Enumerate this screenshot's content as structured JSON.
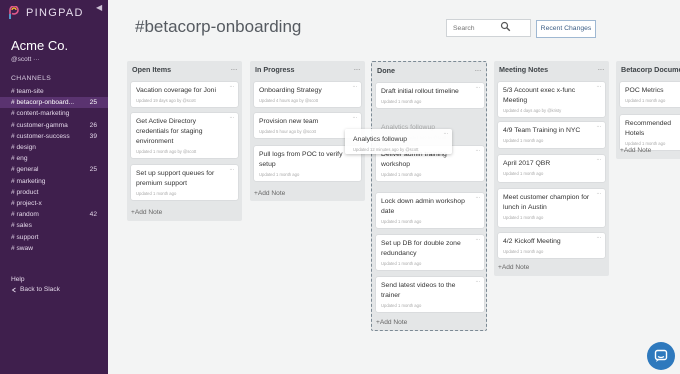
{
  "sidebar": {
    "logo_text": "PINGPAD",
    "org_name": "Acme Co.",
    "user": "@scott ···",
    "channels_heading": "CHANNELS",
    "channels": [
      {
        "name": "# team-site",
        "count": ""
      },
      {
        "name": "# betacorp-onboard...",
        "count": "25",
        "active": true
      },
      {
        "name": "# content-marketing",
        "count": ""
      },
      {
        "name": "# customer-gamma",
        "count": "26"
      },
      {
        "name": "# customer-success",
        "count": "39"
      },
      {
        "name": "# design",
        "count": ""
      },
      {
        "name": "# eng",
        "count": ""
      },
      {
        "name": "# general",
        "count": "25"
      },
      {
        "name": "# marketing",
        "count": ""
      },
      {
        "name": "# product",
        "count": ""
      },
      {
        "name": "# project-x",
        "count": ""
      },
      {
        "name": "# random",
        "count": "42"
      },
      {
        "name": "# sales",
        "count": ""
      },
      {
        "name": "# support",
        "count": ""
      },
      {
        "name": "# swaw",
        "count": ""
      }
    ],
    "help_label": "Help",
    "back_label": "Back to Slack"
  },
  "header": {
    "title": "#betacorp-onboarding",
    "search_placeholder": "Search",
    "recent_changes_label": "Recent Changes"
  },
  "colors": {
    "sidebar_bg": "#3f1f4d",
    "accent_blue": "#2e79bd"
  },
  "columns": [
    {
      "title": "Open Items",
      "cards": [
        {
          "title": "Vacation coverage for Joni",
          "meta": "Updated 19 days ago by @scott"
        },
        {
          "title": "Get Active Directory credentials for staging environment",
          "meta": "Updated 1 month ago by @scott"
        },
        {
          "title": "Set up support queues for premium support",
          "meta": "Updated 1 month ago"
        }
      ],
      "add_note": "+Add Note"
    },
    {
      "title": "In Progress",
      "cards": [
        {
          "title": "Onboarding Strategy",
          "meta": "Updated 4 hours ago by @scott"
        },
        {
          "title": "Provision new team",
          "meta": "Updated 5 hour ago by @scott"
        },
        {
          "title": "Pull logs from POC to verify setup",
          "meta": "Updated 1 month ago"
        }
      ],
      "add_note": "+Add Note"
    },
    {
      "title": "Done",
      "cards": [
        {
          "title": "Draft initial rollout timeline",
          "meta": "Updated 1 month ago"
        },
        {
          "title": "Deliver admin training workshop",
          "meta": "Updated 1 month ago"
        },
        {
          "title": "Lock down admin workshop date",
          "meta": "Updated 1 month ago"
        },
        {
          "title": "Set up DB for double zone redundancy",
          "meta": "Updated 1 month ago"
        },
        {
          "title": "Send latest videos to the trainer",
          "meta": "Updated 1 month ago"
        }
      ],
      "ghost": {
        "title": "Analytics followup",
        "meta": "Updated 12 minutes ago by @scott"
      },
      "add_note": "+Add Note"
    },
    {
      "title": "Meeting Notes",
      "cards": [
        {
          "title": "5/3 Account exec x-func Meeting",
          "meta": "Updated 4 days ago by @kristy"
        },
        {
          "title": "4/9 Team Training in NYC",
          "meta": "Updated 1 month ago"
        },
        {
          "title": "April 2017 QBR",
          "meta": "Updated 1 month ago"
        },
        {
          "title": "Meet customer champion for lunch in Austin",
          "meta": "Updated 1 month ago"
        },
        {
          "title": "4/2 Kickoff Meeting",
          "meta": "Updated 1 month ago"
        }
      ],
      "add_note": "+Add Note"
    },
    {
      "title": "Betacorp Documents",
      "cards": [
        {
          "title": "POC Metrics",
          "meta": "Updated 1 month ago"
        },
        {
          "title": "Recommended Hotels",
          "meta": "Updated 1 month ago"
        }
      ],
      "add_note": "+Add Note"
    }
  ],
  "dragging_card": {
    "title": "Analytics followup",
    "meta": "Updated 12 minutes ago by @scott"
  },
  "card_menu_glyph": "···",
  "column_menu_glyph": "···"
}
